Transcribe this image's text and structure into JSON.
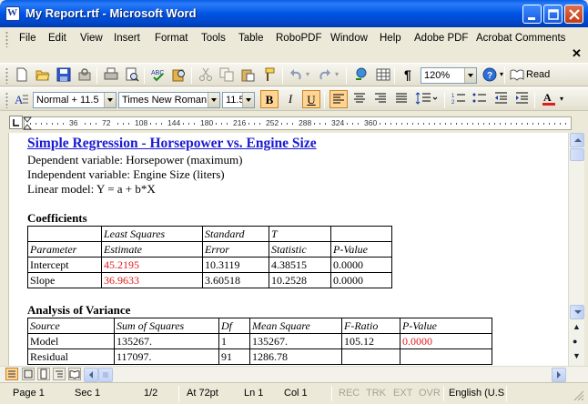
{
  "window": {
    "title": "My Report.rtf - Microsoft Word",
    "app_icon": "word-document-icon"
  },
  "menubar": {
    "items": [
      "File",
      "Edit",
      "View",
      "Insert",
      "Format",
      "Tools",
      "Table",
      "RoboPDF",
      "Window",
      "Help",
      "Adobe PDF",
      "Acrobat Comments"
    ]
  },
  "standard_toolbar": {
    "zoom": "120%",
    "read_label": "Read",
    "icons": [
      "new-icon",
      "open-icon",
      "save-icon",
      "permission-icon",
      "print-icon",
      "print-preview-icon",
      "spelling-icon",
      "research-icon",
      "cut-icon",
      "copy-icon",
      "paste-icon",
      "format-painter-icon",
      "undo-icon",
      "redo-icon",
      "hyperlink-icon",
      "tables-borders-icon",
      "show-formatting-icon",
      "help-icon",
      "read-icon"
    ]
  },
  "formatting_toolbar": {
    "style": "Normal + 11.5",
    "font": "Times New Roman",
    "size": "11.5",
    "bold": "B",
    "italic": "I",
    "underline": "U",
    "highlight_color": "#ffd494",
    "font_color_bar": "#e21c1c"
  },
  "ruler": {
    "labels": [
      "36",
      "72",
      "108",
      "144",
      "180",
      "216",
      "252",
      "288",
      "324",
      "360"
    ]
  },
  "document": {
    "title": "Simple Regression - Horsepower vs. Engine Size",
    "lines": [
      "Dependent variable: Horsepower (maximum)",
      "Independent variable: Engine Size (liters)",
      "Linear model:  Y = a + b*X"
    ],
    "coefficients": {
      "heading": "Coefficients",
      "header_row1": [
        "",
        "Least Squares",
        "Standard",
        "T",
        ""
      ],
      "header_row2": [
        "Parameter",
        "Estimate",
        "Error",
        "Statistic",
        "P-Value"
      ],
      "rows": [
        [
          "Intercept",
          "45.2195",
          "10.3119",
          "4.38515",
          "0.0000"
        ],
        [
          "Slope",
          "36.9633",
          "3.60518",
          "10.2528",
          "0.0000"
        ]
      ]
    },
    "anova": {
      "heading": "Analysis of Variance",
      "header": [
        "Source",
        "Sum of Squares",
        "Df",
        "Mean Square",
        "F-Ratio",
        "P-Value"
      ],
      "rows": [
        [
          "Model",
          "135267.",
          "1",
          "135267.",
          "105.12",
          "0.0000"
        ],
        [
          "Residual",
          "117097.",
          "91",
          "1286.78",
          "",
          ""
        ]
      ]
    },
    "highlight_color": "#e21c1c",
    "title_color": "#1a1ad6"
  },
  "statusbar": {
    "page": "Page  1",
    "sec": "Sec  1",
    "page_of": "1/2",
    "at": "At  72pt",
    "ln": "Ln  1",
    "col": "Col  1",
    "rec": "REC",
    "trk": "TRK",
    "ext": "EXT",
    "ovr": "OVR",
    "language": "English (U.S"
  }
}
